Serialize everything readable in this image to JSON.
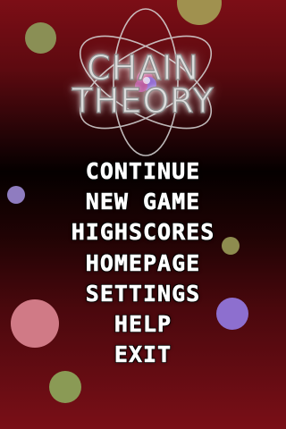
{
  "logo": {
    "line1": "CHAIN",
    "line2": "THEORY"
  },
  "menu": [
    {
      "id": "continue",
      "label": "CONTINUE"
    },
    {
      "id": "new-game",
      "label": "NEW GAME"
    },
    {
      "id": "highscores",
      "label": "HIGHSCORES"
    },
    {
      "id": "homepage",
      "label": "HOMEPAGE"
    },
    {
      "id": "settings",
      "label": "SETTINGS"
    },
    {
      "id": "help",
      "label": "HELP"
    },
    {
      "id": "exit",
      "label": "EXIT"
    }
  ],
  "balls": [
    {
      "color": "#8a8f55"
    },
    {
      "color": "#a0914f"
    },
    {
      "color": "#8f7cc0"
    },
    {
      "color": "#8e8c4f"
    },
    {
      "color": "#8d6fcf"
    },
    {
      "color": "#d07a86"
    },
    {
      "color": "#8a9a55"
    }
  ],
  "colors": {
    "menu_text": "#ffffff",
    "logo_text": "#dcdcdc",
    "background_top": "#7c0e16",
    "background_middle": "#050000",
    "background_bottom": "#7a0f17"
  }
}
